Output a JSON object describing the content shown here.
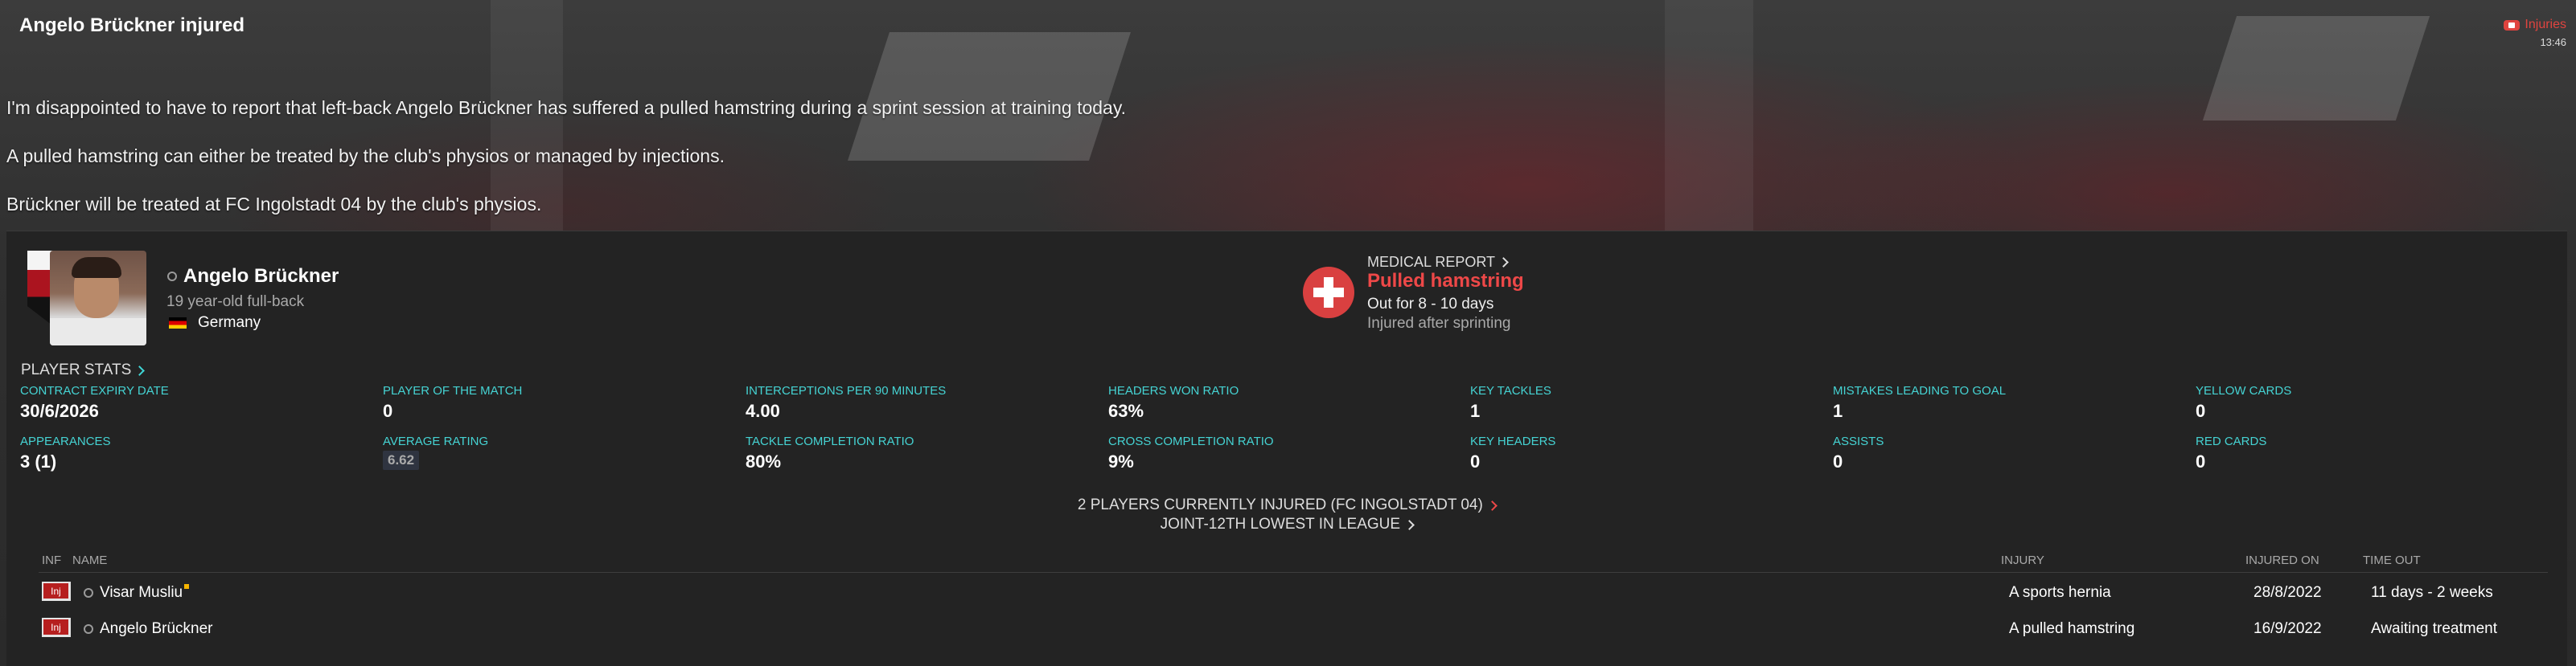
{
  "header": {
    "title": "Angelo Brückner injured",
    "tag_label": "Injuries",
    "tag_time": "13:46"
  },
  "message": {
    "paragraphs": [
      "I'm disappointed to have to report that left-back Angelo Brückner has suffered a pulled hamstring during a sprint session at training today.",
      "A pulled hamstring can either be treated by the club's physios or managed by injections.",
      "Brückner will be treated at FC Ingolstadt 04 by the club's physios."
    ]
  },
  "player": {
    "name": "Angelo Brückner",
    "description": "19 year-old full-back",
    "nationality": "Germany"
  },
  "medical": {
    "report_label": "MEDICAL REPORT",
    "injury": "Pulled hamstring",
    "duration": "Out for 8 - 10 days",
    "cause": "Injured after sprinting"
  },
  "stats": {
    "title": "PLAYER STATS",
    "items": [
      {
        "label": "CONTRACT EXPIRY DATE",
        "value": "30/6/2026"
      },
      {
        "label": "PLAYER OF THE MATCH",
        "value": "0"
      },
      {
        "label": "INTERCEPTIONS PER 90 MINUTES",
        "value": "4.00"
      },
      {
        "label": "HEADERS WON RATIO",
        "value": "63%"
      },
      {
        "label": "KEY TACKLES",
        "value": "1"
      },
      {
        "label": "MISTAKES LEADING TO GOAL",
        "value": "1"
      },
      {
        "label": "YELLOW CARDS",
        "value": "0"
      },
      {
        "label": "APPEARANCES",
        "value": "3 (1)"
      },
      {
        "label": "AVERAGE RATING",
        "value": "6.62"
      },
      {
        "label": "TACKLE COMPLETION RATIO",
        "value": "80%"
      },
      {
        "label": "CROSS COMPLETION RATIO",
        "value": "9%"
      },
      {
        "label": "KEY HEADERS",
        "value": "0"
      },
      {
        "label": "ASSISTS",
        "value": "0"
      },
      {
        "label": "RED CARDS",
        "value": "0"
      }
    ]
  },
  "league": {
    "line1": "2 PLAYERS CURRENTLY INJURED (FC INGOLSTADT 04)",
    "line2": "JOINT-12TH LOWEST IN LEAGUE"
  },
  "injury_table": {
    "columns": {
      "inf": "INF",
      "name": "NAME",
      "injury": "INJURY",
      "injured_on": "INJURED ON",
      "time_out": "TIME OUT"
    },
    "rows": [
      {
        "badge": "Inj",
        "name": "Visar Musliu",
        "injury": "A sports hernia",
        "injured_on": "28/8/2022",
        "time_out": "11 days - 2 weeks"
      },
      {
        "badge": "Inj",
        "name": "Angelo Brückner",
        "injury": "A pulled hamstring",
        "injured_on": "16/9/2022",
        "time_out": "Awaiting treatment"
      }
    ]
  },
  "colors": {
    "accent_cyan": "#45d3d3",
    "injury_red": "#ee4848",
    "panel_bg": "#232323"
  }
}
